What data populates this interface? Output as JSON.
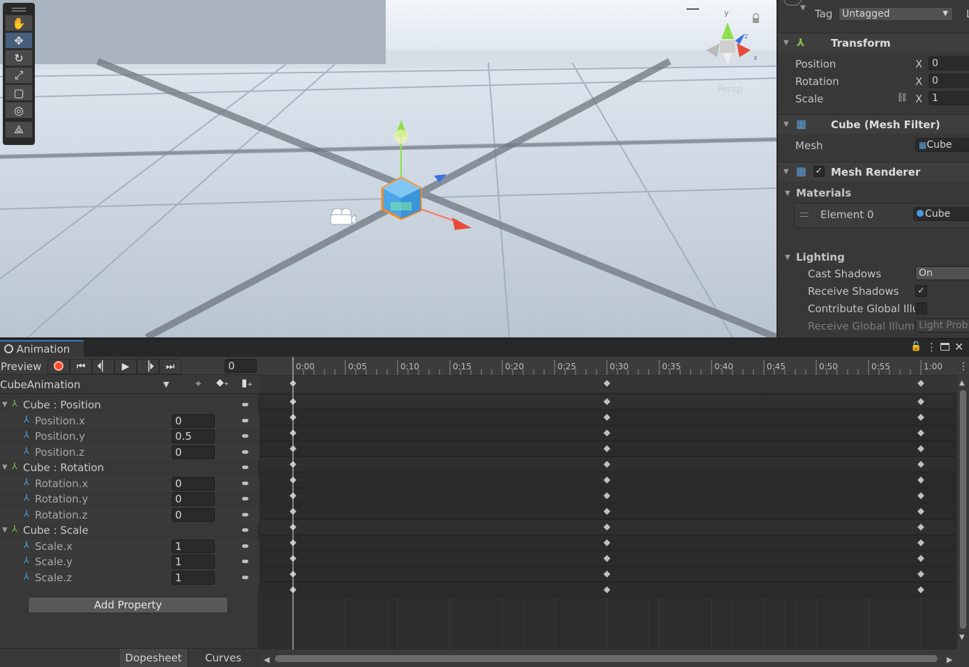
{
  "scene": {
    "persp_label": "Persp",
    "gizmo_axes": [
      "y",
      "z",
      "x"
    ]
  },
  "toolbox": {
    "tools": [
      "hand-tool",
      "move-tool",
      "rotate-tool",
      "scale-tool",
      "rect-tool",
      "transform-tool",
      "custom-tool"
    ],
    "active": "move-tool"
  },
  "inspector": {
    "tag_label": "Tag",
    "tag_value": "Untagged",
    "layer_label": "L",
    "transform": {
      "title": "Transform",
      "rows": [
        {
          "label": "Position",
          "axis": "X",
          "value": "0"
        },
        {
          "label": "Rotation",
          "axis": "X",
          "value": "0"
        },
        {
          "label": "Scale",
          "axis": "X",
          "value": "1"
        }
      ]
    },
    "mesh_filter": {
      "title": "Cube (Mesh Filter)",
      "mesh_label": "Mesh",
      "mesh_value": "Cube"
    },
    "mesh_renderer": {
      "title": "Mesh Renderer",
      "enabled": true
    },
    "materials": {
      "title": "Materials",
      "element_label": "Element 0",
      "element_value": "Cube"
    },
    "lighting": {
      "title": "Lighting",
      "cast_shadows_label": "Cast Shadows",
      "cast_shadows_value": "On",
      "receive_shadows_label": "Receive Shadows",
      "receive_shadows": true,
      "contribute_gi_label": "Contribute Global Illu",
      "contribute_gi": false,
      "receive_gi_label": "Receive Global Illumi",
      "receive_gi_value": "Light Prob"
    }
  },
  "animation": {
    "tab_title": "Animation",
    "preview_label": "Preview",
    "frame_value": "0",
    "clip_name": "CubeAnimation",
    "groups": [
      {
        "label": "Cube : Position",
        "props": [
          {
            "label": "Position.x",
            "value": "0"
          },
          {
            "label": "Position.y",
            "value": "0.5"
          },
          {
            "label": "Position.z",
            "value": "0"
          }
        ]
      },
      {
        "label": "Cube : Rotation",
        "props": [
          {
            "label": "Rotation.x",
            "value": "0"
          },
          {
            "label": "Rotation.y",
            "value": "0"
          },
          {
            "label": "Rotation.z",
            "value": "0"
          }
        ]
      },
      {
        "label": "Cube : Scale",
        "props": [
          {
            "label": "Scale.x",
            "value": "1"
          },
          {
            "label": "Scale.y",
            "value": "1"
          },
          {
            "label": "Scale.z",
            "value": "1"
          }
        ]
      }
    ],
    "add_property_label": "Add Property",
    "dopesheet_label": "Dopesheet",
    "curves_label": "Curves",
    "timeline_ticks": [
      "0:00",
      "0:05",
      "0:10",
      "0:15",
      "0:20",
      "0:25",
      "0:30",
      "0:35",
      "0:40",
      "0:45",
      "0:50",
      "0:55",
      "1:00"
    ],
    "keyframe_times": [
      "0:00",
      "0:30",
      "1:00"
    ]
  }
}
